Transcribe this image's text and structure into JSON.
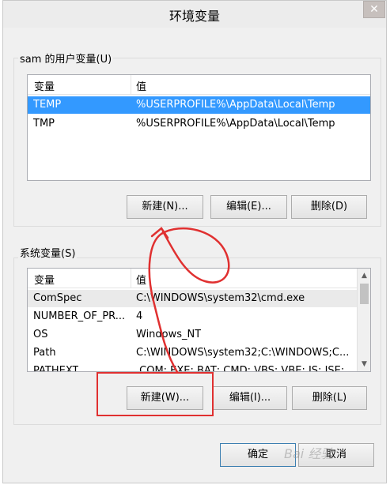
{
  "window": {
    "title": "环境变量",
    "close_glyph": "✕"
  },
  "user_section": {
    "label": "sam 的用户变量(U)",
    "columns": [
      "变量",
      "值"
    ],
    "rows": [
      {
        "name": "TEMP",
        "value": "%USERPROFILE%\\AppData\\Local\\Temp",
        "selected": true
      },
      {
        "name": "TMP",
        "value": "%USERPROFILE%\\AppData\\Local\\Temp",
        "selected": false
      }
    ],
    "buttons": {
      "new": "新建(N)...",
      "edit": "编辑(E)...",
      "delete": "删除(D)"
    }
  },
  "system_section": {
    "label": "系统变量(S)",
    "columns": [
      "变量",
      "值"
    ],
    "rows": [
      {
        "name": "ComSpec",
        "value": "C:\\WINDOWS\\system32\\cmd.exe",
        "highlight": true
      },
      {
        "name": "NUMBER_OF_PR...",
        "value": "4",
        "highlight": false
      },
      {
        "name": "OS",
        "value": "Windows_NT",
        "highlight": false
      },
      {
        "name": "Path",
        "value": "C:\\WINDOWS\\system32;C:\\WINDOWS;C...",
        "highlight": false
      },
      {
        "name": "PATHEXT",
        "value": ".COM;.EXE;.BAT;.CMD;.VBS;.VBE;.JS;.JSE;...",
        "highlight": false
      }
    ],
    "buttons": {
      "new": "新建(W)...",
      "edit": "编辑(I)...",
      "delete": "删除(L)"
    }
  },
  "footer": {
    "ok": "确定",
    "cancel": "取消"
  },
  "watermark": "Bai 经验",
  "colors": {
    "selection": "#3399ff",
    "annotation": "#e03030",
    "dialog_bg": "#f0f0f0"
  },
  "icons": {
    "close": "close-icon",
    "scroll_up": "scroll-up-icon",
    "scroll_down": "scroll-down-icon"
  }
}
